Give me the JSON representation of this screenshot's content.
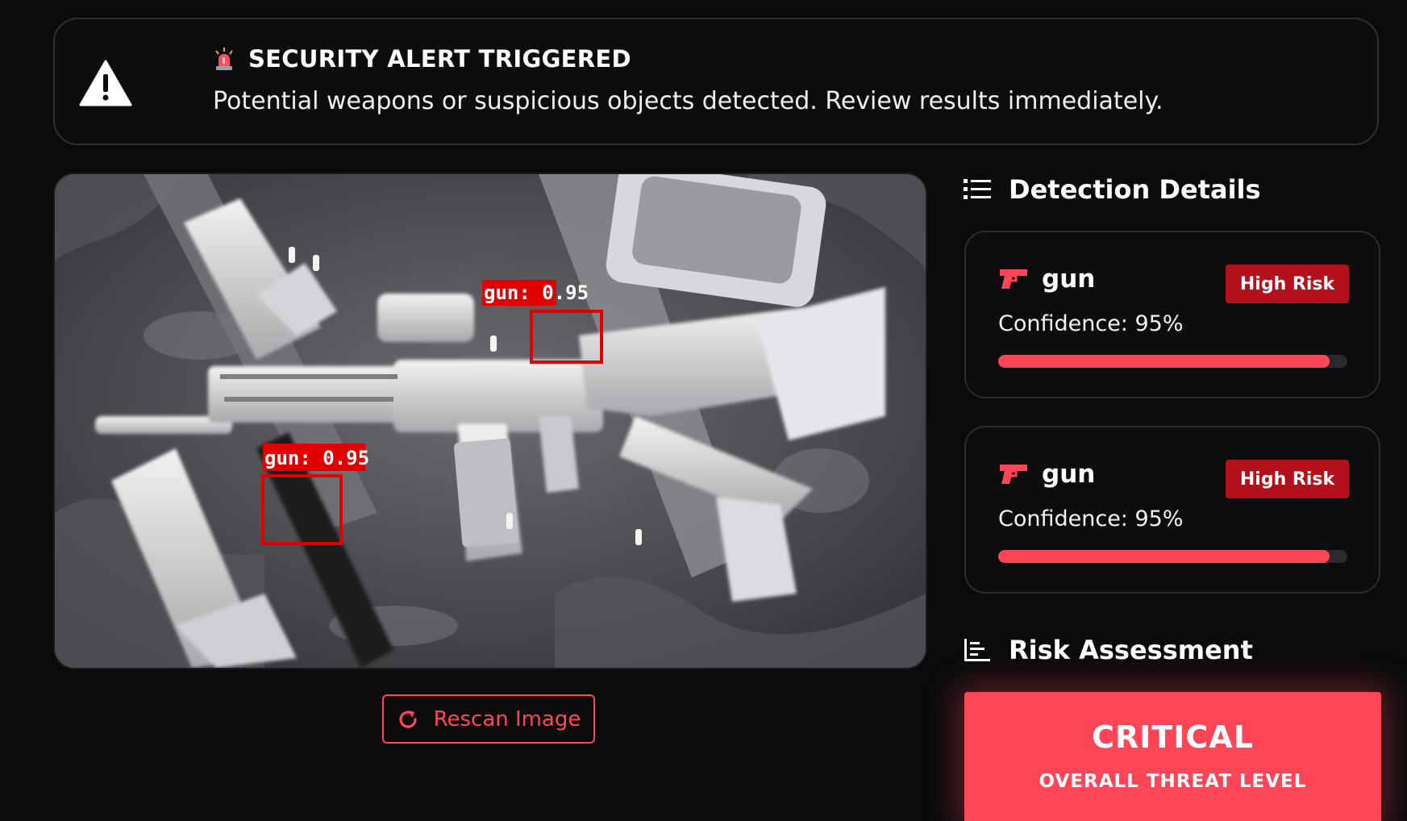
{
  "alert": {
    "title": "SECURITY ALERT TRIGGERED",
    "message": "Potential weapons or suspicious objects detected. Review results immediately.",
    "icon": "warning-triangle-icon",
    "title_icon": "siren-icon"
  },
  "scan_image": {
    "detections": [
      {
        "label": "gun: 0.95"
      },
      {
        "label": "gun: 0.95"
      }
    ],
    "box_color": "#e00000"
  },
  "rescan": {
    "label": "Rescan Image",
    "icon": "refresh-icon"
  },
  "detection_details": {
    "heading": "Detection Details",
    "icon": "list-icon",
    "items": [
      {
        "label": "gun",
        "risk": "High Risk",
        "confidence_text": "Confidence: 95%",
        "confidence": 0.95,
        "icon": "gun-icon"
      },
      {
        "label": "gun",
        "risk": "High Risk",
        "confidence_text": "Confidence: 95%",
        "confidence": 0.95,
        "icon": "gun-icon"
      }
    ]
  },
  "risk_assessment": {
    "heading": "Risk Assessment",
    "icon": "bar-chart-icon",
    "level": "CRITICAL",
    "caption": "OVERALL THREAT LEVEL"
  },
  "colors": {
    "accent": "#ff4656",
    "badge": "#b3101c",
    "background": "#0b0b0c"
  }
}
